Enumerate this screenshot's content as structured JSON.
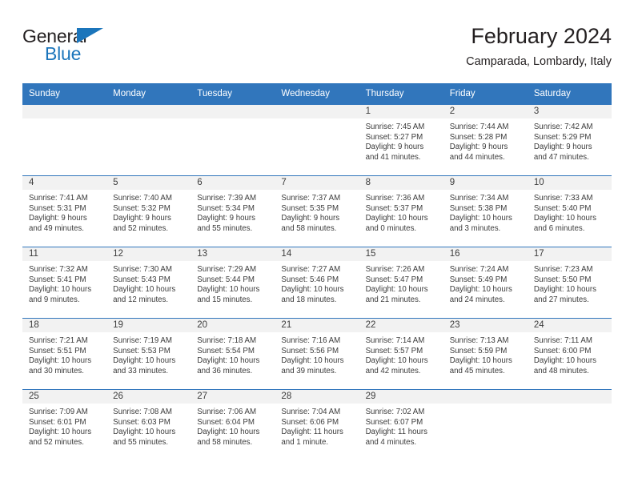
{
  "brand": {
    "name_part1": "General",
    "name_part2": "Blue",
    "triangle_color": "#1b75bb"
  },
  "header": {
    "title": "February 2024",
    "subtitle": "Camparada, Lombardy, Italy"
  },
  "theme": {
    "header_blue": "#3176bc",
    "daynum_band": "#f2f2f2",
    "text": "#3c3c3c"
  },
  "weekday_headers": [
    "Sunday",
    "Monday",
    "Tuesday",
    "Wednesday",
    "Thursday",
    "Friday",
    "Saturday"
  ],
  "weeks": [
    [
      {
        "day": ""
      },
      {
        "day": ""
      },
      {
        "day": ""
      },
      {
        "day": ""
      },
      {
        "day": "1",
        "sunrise": "Sunrise: 7:45 AM",
        "sunset": "Sunset: 5:27 PM",
        "daylight1": "Daylight: 9 hours",
        "daylight2": "and 41 minutes."
      },
      {
        "day": "2",
        "sunrise": "Sunrise: 7:44 AM",
        "sunset": "Sunset: 5:28 PM",
        "daylight1": "Daylight: 9 hours",
        "daylight2": "and 44 minutes."
      },
      {
        "day": "3",
        "sunrise": "Sunrise: 7:42 AM",
        "sunset": "Sunset: 5:29 PM",
        "daylight1": "Daylight: 9 hours",
        "daylight2": "and 47 minutes."
      }
    ],
    [
      {
        "day": "4",
        "sunrise": "Sunrise: 7:41 AM",
        "sunset": "Sunset: 5:31 PM",
        "daylight1": "Daylight: 9 hours",
        "daylight2": "and 49 minutes."
      },
      {
        "day": "5",
        "sunrise": "Sunrise: 7:40 AM",
        "sunset": "Sunset: 5:32 PM",
        "daylight1": "Daylight: 9 hours",
        "daylight2": "and 52 minutes."
      },
      {
        "day": "6",
        "sunrise": "Sunrise: 7:39 AM",
        "sunset": "Sunset: 5:34 PM",
        "daylight1": "Daylight: 9 hours",
        "daylight2": "and 55 minutes."
      },
      {
        "day": "7",
        "sunrise": "Sunrise: 7:37 AM",
        "sunset": "Sunset: 5:35 PM",
        "daylight1": "Daylight: 9 hours",
        "daylight2": "and 58 minutes."
      },
      {
        "day": "8",
        "sunrise": "Sunrise: 7:36 AM",
        "sunset": "Sunset: 5:37 PM",
        "daylight1": "Daylight: 10 hours",
        "daylight2": "and 0 minutes."
      },
      {
        "day": "9",
        "sunrise": "Sunrise: 7:34 AM",
        "sunset": "Sunset: 5:38 PM",
        "daylight1": "Daylight: 10 hours",
        "daylight2": "and 3 minutes."
      },
      {
        "day": "10",
        "sunrise": "Sunrise: 7:33 AM",
        "sunset": "Sunset: 5:40 PM",
        "daylight1": "Daylight: 10 hours",
        "daylight2": "and 6 minutes."
      }
    ],
    [
      {
        "day": "11",
        "sunrise": "Sunrise: 7:32 AM",
        "sunset": "Sunset: 5:41 PM",
        "daylight1": "Daylight: 10 hours",
        "daylight2": "and 9 minutes."
      },
      {
        "day": "12",
        "sunrise": "Sunrise: 7:30 AM",
        "sunset": "Sunset: 5:43 PM",
        "daylight1": "Daylight: 10 hours",
        "daylight2": "and 12 minutes."
      },
      {
        "day": "13",
        "sunrise": "Sunrise: 7:29 AM",
        "sunset": "Sunset: 5:44 PM",
        "daylight1": "Daylight: 10 hours",
        "daylight2": "and 15 minutes."
      },
      {
        "day": "14",
        "sunrise": "Sunrise: 7:27 AM",
        "sunset": "Sunset: 5:46 PM",
        "daylight1": "Daylight: 10 hours",
        "daylight2": "and 18 minutes."
      },
      {
        "day": "15",
        "sunrise": "Sunrise: 7:26 AM",
        "sunset": "Sunset: 5:47 PM",
        "daylight1": "Daylight: 10 hours",
        "daylight2": "and 21 minutes."
      },
      {
        "day": "16",
        "sunrise": "Sunrise: 7:24 AM",
        "sunset": "Sunset: 5:49 PM",
        "daylight1": "Daylight: 10 hours",
        "daylight2": "and 24 minutes."
      },
      {
        "day": "17",
        "sunrise": "Sunrise: 7:23 AM",
        "sunset": "Sunset: 5:50 PM",
        "daylight1": "Daylight: 10 hours",
        "daylight2": "and 27 minutes."
      }
    ],
    [
      {
        "day": "18",
        "sunrise": "Sunrise: 7:21 AM",
        "sunset": "Sunset: 5:51 PM",
        "daylight1": "Daylight: 10 hours",
        "daylight2": "and 30 minutes."
      },
      {
        "day": "19",
        "sunrise": "Sunrise: 7:19 AM",
        "sunset": "Sunset: 5:53 PM",
        "daylight1": "Daylight: 10 hours",
        "daylight2": "and 33 minutes."
      },
      {
        "day": "20",
        "sunrise": "Sunrise: 7:18 AM",
        "sunset": "Sunset: 5:54 PM",
        "daylight1": "Daylight: 10 hours",
        "daylight2": "and 36 minutes."
      },
      {
        "day": "21",
        "sunrise": "Sunrise: 7:16 AM",
        "sunset": "Sunset: 5:56 PM",
        "daylight1": "Daylight: 10 hours",
        "daylight2": "and 39 minutes."
      },
      {
        "day": "22",
        "sunrise": "Sunrise: 7:14 AM",
        "sunset": "Sunset: 5:57 PM",
        "daylight1": "Daylight: 10 hours",
        "daylight2": "and 42 minutes."
      },
      {
        "day": "23",
        "sunrise": "Sunrise: 7:13 AM",
        "sunset": "Sunset: 5:59 PM",
        "daylight1": "Daylight: 10 hours",
        "daylight2": "and 45 minutes."
      },
      {
        "day": "24",
        "sunrise": "Sunrise: 7:11 AM",
        "sunset": "Sunset: 6:00 PM",
        "daylight1": "Daylight: 10 hours",
        "daylight2": "and 48 minutes."
      }
    ],
    [
      {
        "day": "25",
        "sunrise": "Sunrise: 7:09 AM",
        "sunset": "Sunset: 6:01 PM",
        "daylight1": "Daylight: 10 hours",
        "daylight2": "and 52 minutes."
      },
      {
        "day": "26",
        "sunrise": "Sunrise: 7:08 AM",
        "sunset": "Sunset: 6:03 PM",
        "daylight1": "Daylight: 10 hours",
        "daylight2": "and 55 minutes."
      },
      {
        "day": "27",
        "sunrise": "Sunrise: 7:06 AM",
        "sunset": "Sunset: 6:04 PM",
        "daylight1": "Daylight: 10 hours",
        "daylight2": "and 58 minutes."
      },
      {
        "day": "28",
        "sunrise": "Sunrise: 7:04 AM",
        "sunset": "Sunset: 6:06 PM",
        "daylight1": "Daylight: 11 hours",
        "daylight2": "and 1 minute."
      },
      {
        "day": "29",
        "sunrise": "Sunrise: 7:02 AM",
        "sunset": "Sunset: 6:07 PM",
        "daylight1": "Daylight: 11 hours",
        "daylight2": "and 4 minutes."
      },
      {
        "day": ""
      },
      {
        "day": ""
      }
    ]
  ]
}
